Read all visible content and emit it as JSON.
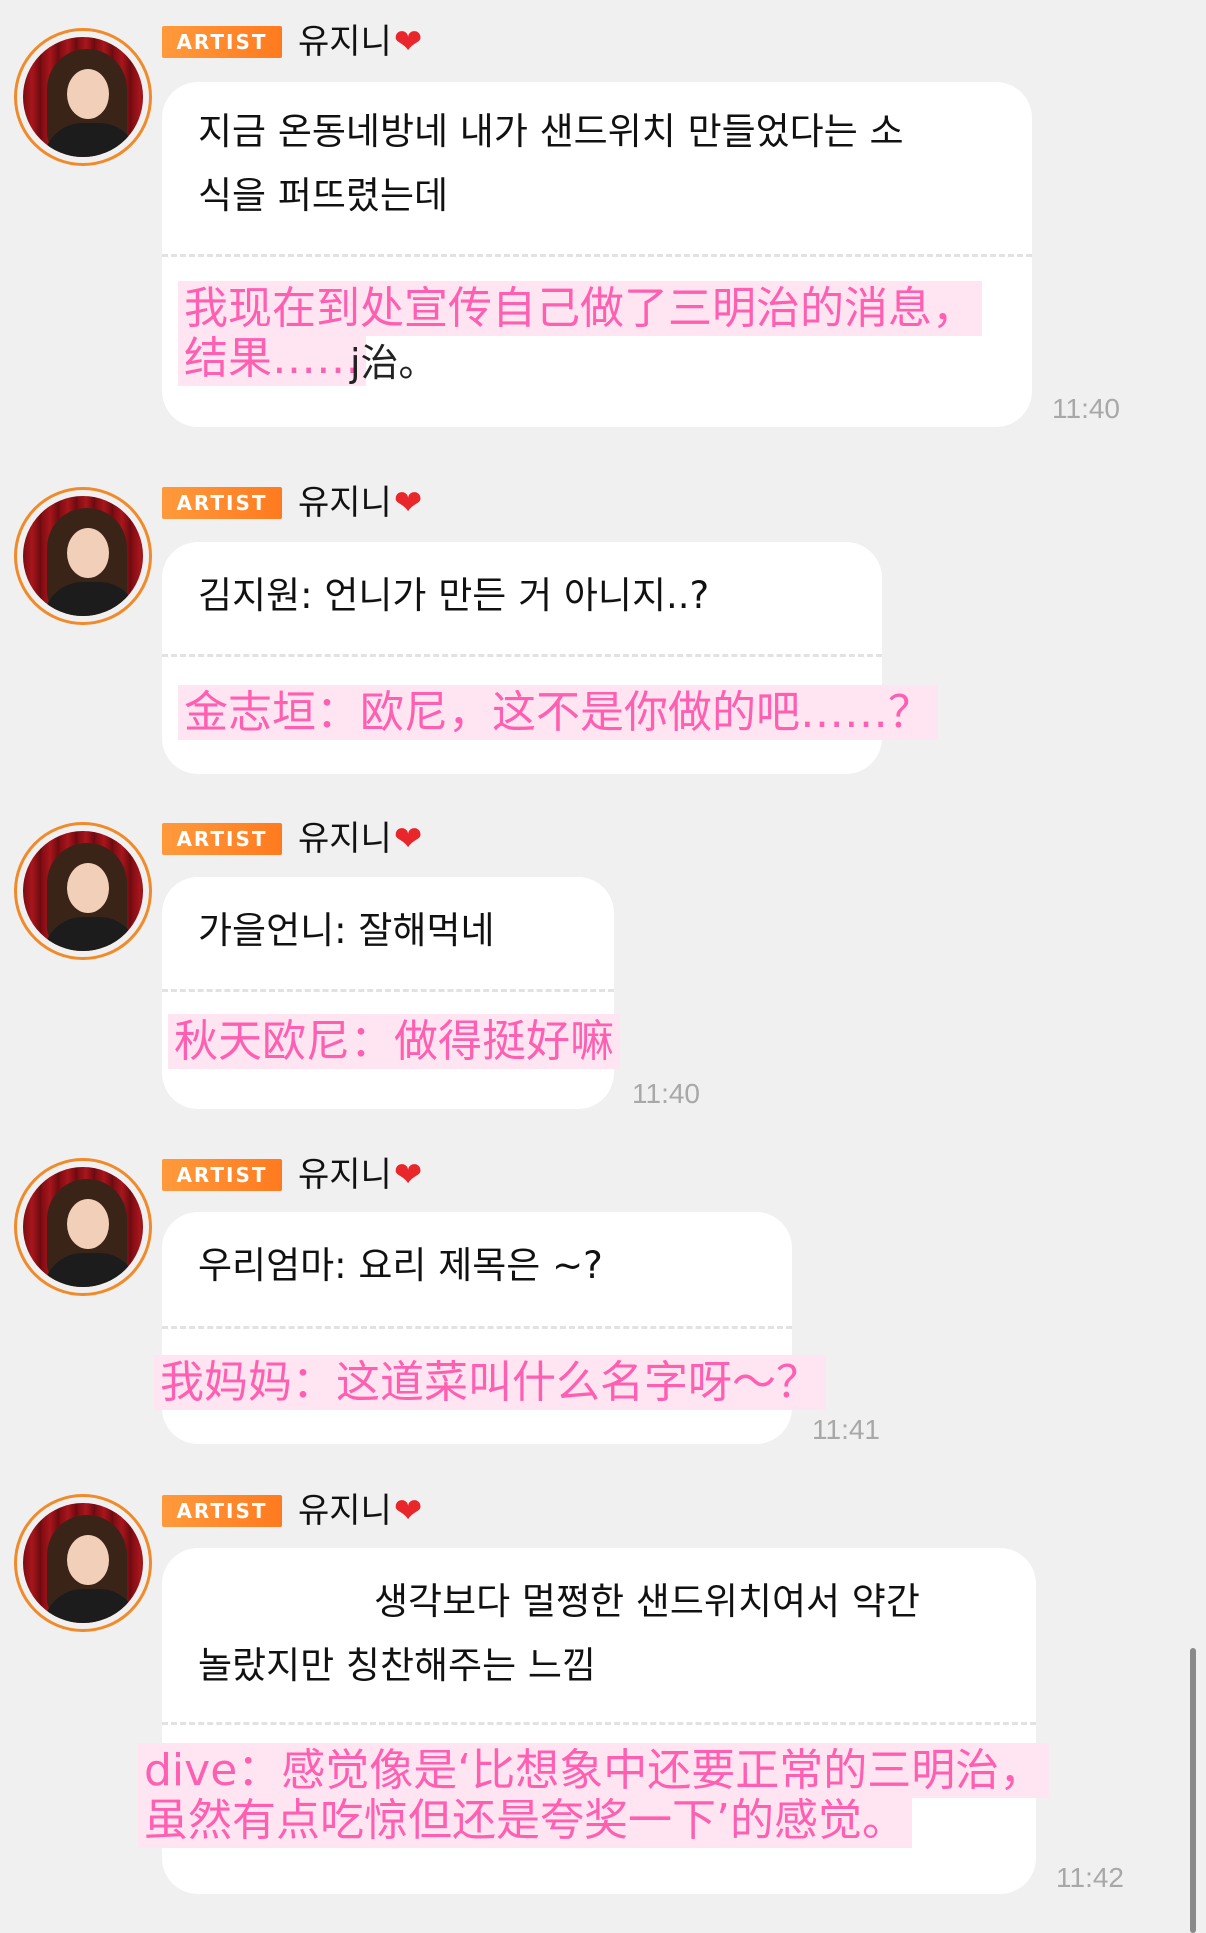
{
  "artist_badge_label": "ARTIST",
  "sender_name": "유지니",
  "heart_icon": "❤",
  "messages": [
    {
      "ko": "지금 온동네방네 내가 샌드위치 만들었다는 소\n식을 퍼뜨렸는데",
      "zh": "我现在到处宣传自己做了三明治的消息，\n结果……",
      "zh_partial": "j治。",
      "time": "11:40"
    },
    {
      "ko": "김지원: 언니가 만든 거 아니지..?",
      "zh": "金志垣：欧尼，这不是你做的吧……？",
      "time": ""
    },
    {
      "ko": "가을언니: 잘해먹네",
      "zh": "秋天欧尼：做得挺好嘛",
      "time": "11:40"
    },
    {
      "ko": "우리엄마: 요리 제목은 ~?",
      "zh": "我妈妈：这道菜叫什么名字呀～？",
      "time": "11:41"
    },
    {
      "ko": "생각보다 멀쩡한 샌드위치여서 약간\n놀랐지만 칭찬해주는 느낌",
      "zh": "dive：感觉像是‘比想象中还要正常的三明治，\n虽然有点吃惊但还是夸奖一下’的感觉。",
      "time": "11:42"
    }
  ]
}
